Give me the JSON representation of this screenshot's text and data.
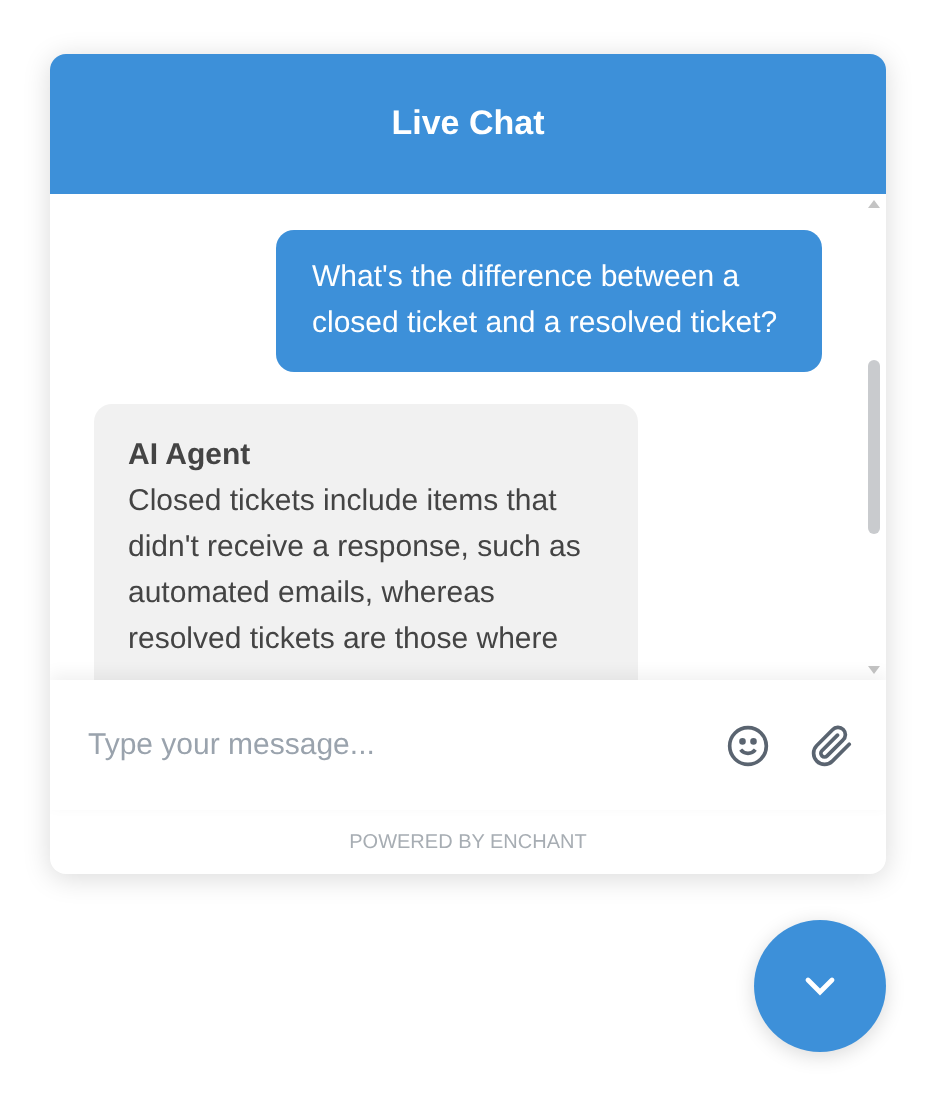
{
  "header": {
    "title": "Live Chat"
  },
  "messages": [
    {
      "kind": "user",
      "text": "What's the difference between a closed ticket and a resolved ticket?"
    },
    {
      "kind": "agent",
      "author": "AI Agent",
      "text": "Closed tickets include items that didn't receive a response, such as automated emails, whereas resolved tickets are those where"
    }
  ],
  "composer": {
    "placeholder": "Type your message..."
  },
  "footer": "POWERED BY ENCHANT"
}
